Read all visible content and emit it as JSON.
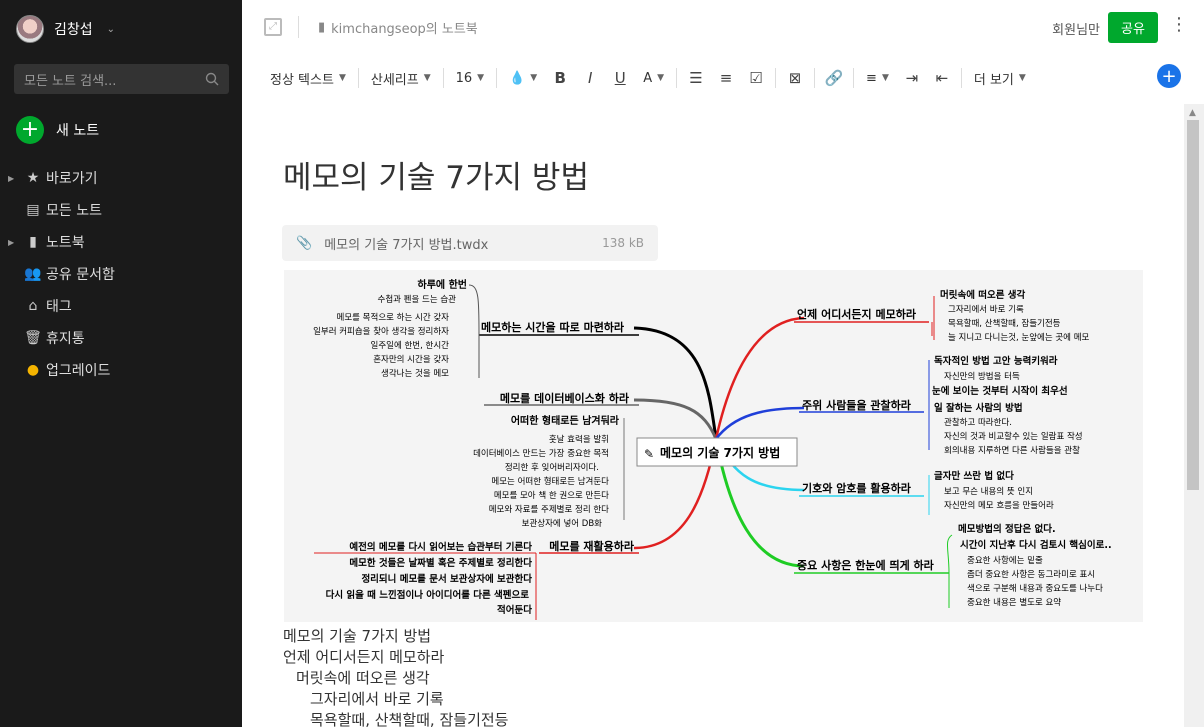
{
  "sidebar": {
    "user_name": "김창섭",
    "search_placeholder": "모든 노트 검색...",
    "new_note": "새 노트",
    "items": [
      {
        "label": "바로가기",
        "icon": "star-icon",
        "expandable": true
      },
      {
        "label": "모든 노트",
        "icon": "notes-icon",
        "expandable": false
      },
      {
        "label": "노트북",
        "icon": "notebook-icon",
        "expandable": true
      },
      {
        "label": "공유 문서함",
        "icon": "people-icon",
        "expandable": false
      },
      {
        "label": "태그",
        "icon": "tag-icon",
        "expandable": false
      },
      {
        "label": "휴지통",
        "icon": "trash-icon",
        "expandable": false
      },
      {
        "label": "업그레이드",
        "icon": "upgrade-icon",
        "expandable": false
      }
    ]
  },
  "topbar": {
    "notebook": "kimchangseop의 노트북",
    "members": "회원님만",
    "share": "공유"
  },
  "toolbar": {
    "text_style": "정상 텍스트",
    "font": "산세리프",
    "font_size": "16",
    "more": "더 보기"
  },
  "note": {
    "title": "메모의 기술 7가지 방법",
    "attachment_name": "메모의 기술 7가지 방법.twdx",
    "attachment_size": "138 kB",
    "body_lines": [
      "메모의 기술 7가지 방법",
      "언제 어디서든지 메모하라",
      "머릿속에 떠오른 생각",
      "그자리에서 바로 기록",
      "목욕할때, 산책할때, 잠들기전등"
    ]
  },
  "mindmap": {
    "center": "메모의 기술 7가지 방법",
    "branches": {
      "b1": {
        "title": "메모하는 시간을 따로 마련하라",
        "items": [
          "하루에 한번",
          "수첩과 펜을 드는 습관",
          "메모를 목적으로 하는 시간 갖자",
          "일부러 커피숍을 찾아 생각을 정리하자",
          "일주일에 한번, 한시간",
          "혼자만의 시간을 갖자",
          "생각나는 것을 메모"
        ]
      },
      "b2": {
        "title": "메모를 데이터베이스화 하라",
        "sub": "어떠한 형태로든 남겨둬라",
        "items": [
          "훗날 효력을 발휘",
          "데이터베이스 만드는 가장 중요한 목적",
          "정리한 후 잊어버리자이다.",
          "메모는 어떠한 형태로든 남겨둔다",
          "메모를 모아 책 한 권으로 만든다",
          "메모와 자료를 주제별로 정리 한다",
          "보관상자에 넣어 DB화"
        ]
      },
      "b3": {
        "title": "메모를 재활용하라",
        "items": [
          "예전의 메모를 다시 읽어보는 습관부터 기른다",
          "메모한 것들은 날짜별 혹은 주제별로 정리한다",
          "정리되니 메모를 문서 보관상자에 보관한다",
          "다시 읽을 때 느낀점이나 아이디어를 다른 색펜으로",
          "적어둔다"
        ]
      },
      "b4": {
        "title": "언제 어디서든지 메모하라",
        "sub": "머릿속에 떠오른 생각",
        "items": [
          "그자리에서 바로 기록",
          "목욕할때, 산책할때, 잠들기전등",
          "늘 지니고 다니는것, 눈앞에는 곳에 메모"
        ]
      },
      "b5": {
        "title": "주위 사람들을 관찰하라",
        "subs": [
          "독자적인 방법 고안 능력키워라",
          "눈에 보이는 것부터 시작이 최우선",
          "일 잘하는 사람의 방법"
        ],
        "items": [
          "자신만의 방법을 터득",
          "관찰하고 따라한다.",
          "자신의 것과 비교할수 있는 일람표 작성",
          "회의내용 지루하면 다른 사람들을 관찰"
        ]
      },
      "b6": {
        "title": "기호와 암호를 활용하라",
        "sub": "글자만 쓰란 법 없다",
        "items": [
          "보고 무슨 내용의 뜻 인지",
          "자신만의 메모 흐름을 만들어라"
        ]
      },
      "b7": {
        "title": "중요 사항은 한눈에 띄게 하라",
        "subs": [
          "메모방법의 정답은 없다.",
          "시간이 지난후 다시 검토시 핵심이로.."
        ],
        "items": [
          "중요한 사항에는 밑줄",
          "좀더 중요한 사항은 동그라미로 표시",
          "색으로 구분해 내용과 중요도를 나누다",
          "중요한 내용은 별도로 요약"
        ]
      }
    }
  }
}
